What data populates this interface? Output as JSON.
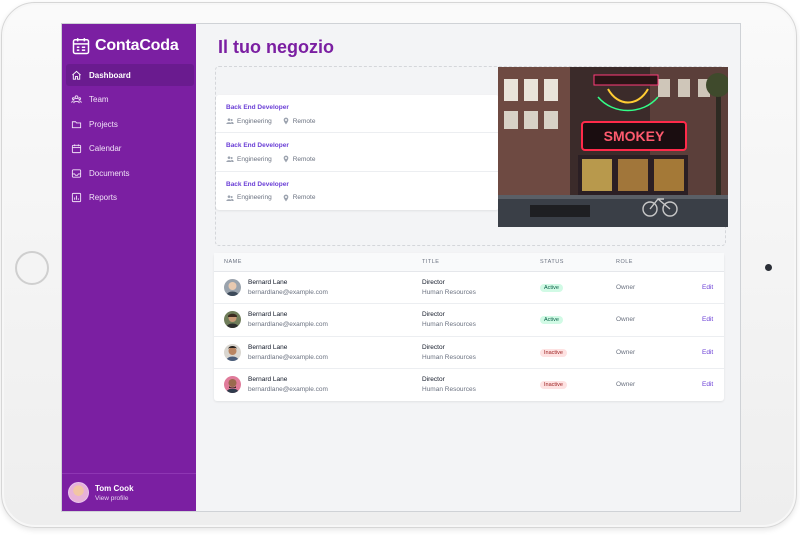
{
  "app": {
    "brand_name": "ContaCoda"
  },
  "sidebar": {
    "items": [
      {
        "label": "Dashboard",
        "icon": "home-icon",
        "active": true
      },
      {
        "label": "Team",
        "icon": "users-icon",
        "active": false
      },
      {
        "label": "Projects",
        "icon": "folder-icon",
        "active": false
      },
      {
        "label": "Calendar",
        "icon": "calendar-icon",
        "active": false
      },
      {
        "label": "Documents",
        "icon": "inbox-icon",
        "active": false
      },
      {
        "label": "Reports",
        "icon": "chart-bar-icon",
        "active": false
      }
    ],
    "profile": {
      "name": "Tom Cook",
      "sublabel": "View profile"
    }
  },
  "main": {
    "title": "Il tuo negozio",
    "jobs": [
      {
        "title": "Back End Developer",
        "department": "Engineering",
        "location": "Remote"
      },
      {
        "title": "Back End Developer",
        "department": "Engineering",
        "location": "Remote"
      },
      {
        "title": "Back End Developer",
        "department": "Engineering",
        "location": "Remote"
      }
    ],
    "table": {
      "headers": {
        "name": "Name",
        "title": "Title",
        "status": "Status",
        "role": "Role"
      },
      "rows": [
        {
          "name": "Bernard Lane",
          "email": "bernardlane@example.com",
          "title": "Director",
          "department": "Human Resources",
          "status": "Active",
          "role": "Owner",
          "action": "Edit"
        },
        {
          "name": "Bernard Lane",
          "email": "bernardlane@example.com",
          "title": "Director",
          "department": "Human Resources",
          "status": "Active",
          "role": "Owner",
          "action": "Edit"
        },
        {
          "name": "Bernard Lane",
          "email": "bernardlane@example.com",
          "title": "Director",
          "department": "Human Resources",
          "status": "Inactive",
          "role": "Owner",
          "action": "Edit"
        },
        {
          "name": "Bernard Lane",
          "email": "bernardlane@example.com",
          "title": "Director",
          "department": "Human Resources",
          "status": "Inactive",
          "role": "Owner",
          "action": "Edit"
        }
      ]
    }
  },
  "colors": {
    "brand": "#7b1fa2",
    "sidebar_active": "#6a1b8f",
    "link": "#6b3fd6",
    "active_badge": "#d1fae5",
    "inactive_badge": "#fee2e2"
  }
}
